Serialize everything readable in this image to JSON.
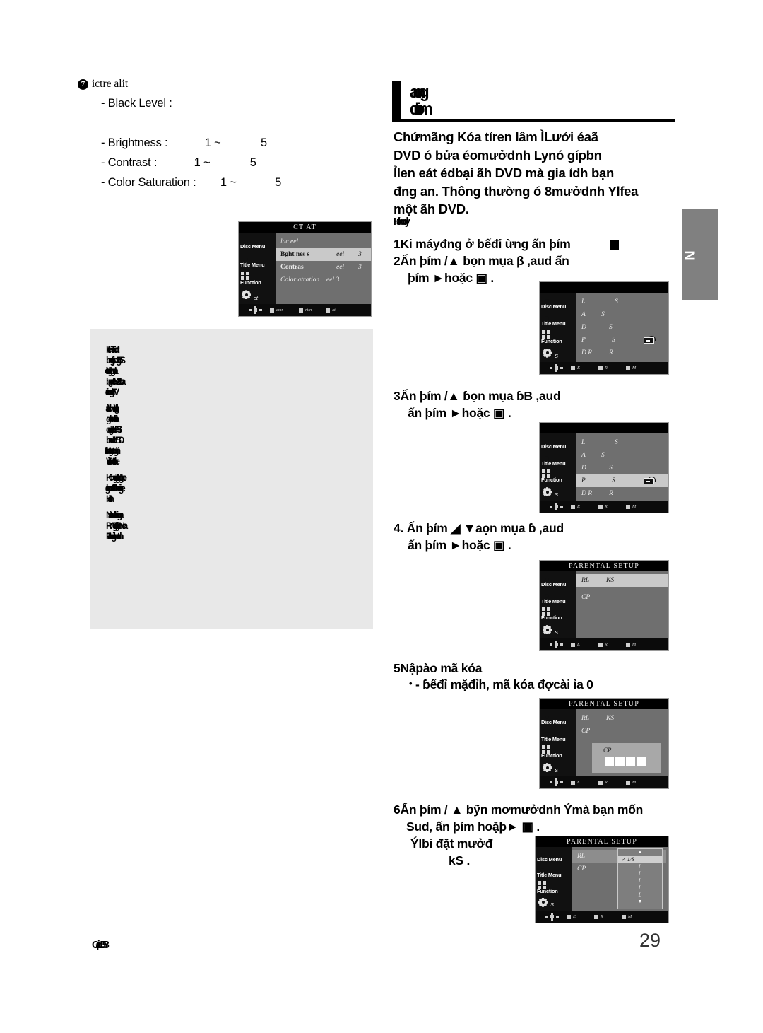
{
  "page": {
    "number": "29",
    "footer_code": "Gaip1058",
    "side_tab_letter": "N"
  },
  "left_column": {
    "section": {
      "bullet": "7",
      "heading": "ictre alit"
    },
    "settings": [
      {
        "label": "- Black Level :",
        "range": ""
      },
      {
        "label": "- Brightness :",
        "range": "1 ~",
        "max": "5"
      },
      {
        "label": "- Contrast :",
        "range": "1 ~",
        "max": "5"
      },
      {
        "label": "- Color Saturation :",
        "range": "1 ~",
        "max": "5"
      }
    ],
    "osd": {
      "title": "CT AT",
      "sidebar": [
        {
          "label": "Disc Menu",
          "icon": "disc-icon",
          "active": false
        },
        {
          "label": "Title Menu",
          "icon": "title-icon",
          "active": false
        },
        {
          "label": "Function",
          "icon": "function-icon",
          "active": false
        },
        {
          "label": "et",
          "icon": "gear-icon",
          "active": false
        }
      ],
      "rows": [
        {
          "c1": "lac eel",
          "c2": "",
          "c3": "",
          "selected": false
        },
        {
          "c1": "Bght nes s",
          "c2": "eel",
          "c3": "3",
          "selected": true
        },
        {
          "c1": "Contras",
          "c2": "eel",
          "c3": "3",
          "selected": false
        },
        {
          "c1": "Color atration",
          "c2": "eel 3",
          "c3": "",
          "selected": false
        }
      ],
      "footer": [
        "cmr",
        "rtin",
        "xt"
      ]
    },
    "note_lines": [
      "kfenTiacdt",
      "bngjtobJg5S",
      "tdg tiodvgnla",
      "bgnteleV2ctba",
      "icitongtleTV",
      "tatidchvietdlg",
      "gelndditnla",
      "cdigertloeFSi",
      "bndeIVBD",
      "leo lMgretoghi",
      "VlialsHtdtne",
      "Kchgiegltlotdgke",
      "lgndtdbhnieige",
      "Htiatlea",
      "Niatadchiegra",
      "RWZ gtelghNea",
      "Ftathcighetdn"
    ]
  },
  "right_column": {
    "header": {
      "line1": "anng",
      "line2": "dniom"
    },
    "intro": [
      "Chứmãng Kóa tỉren lâm ÌLưởi éaã",
      "DVD ó bửa éomưởdnh Lynó gípbn",
      "Ỉlen eát édbại ãh DVD mà gia ỉdh bạn",
      "đng an. Thông thường ó 8mưởdnh Ylfea",
      "một ãh DVD."
    ],
    "sec_label": "Hfanody",
    "steps": [
      {
        "n": "1",
        "lines": [
          "Ki máyđng ở bếđỉ ừng ấn þím"
        ],
        "trailing_icon": "button-icon"
      },
      {
        "n": "2",
        "lines": [
          "Ấn þím      /▲  bọn mụa            β           ,aud ấn",
          "þím   ►hoặc  ▣        ."
        ]
      },
      {
        "n": "3",
        "lines": [
          "Ấn þím      /▲  ɓọn mụa            ɓB              ,aud",
          "ấn þím   ►hoặc  ▣        ."
        ]
      },
      {
        "n": "4.",
        "lines": [
          "Ấn þím    ◢  ▼aọn mụa          ɓ              ,aud",
          "ấn þím   ►hoặc  ▣        ."
        ]
      },
      {
        "n": "5",
        "lines": [
          "Nậpào mã kóa",
          "- ɓếđỉ mặđỉh, mã kóa đợcài ỉa 0"
        ]
      },
      {
        "n": "6",
        "lines": [
          "Ấn þím    / ▲ bỹn mơmưởdnh Ýmà bạn mốn",
          "Sud, ấn þím      hoặþ►       ▣        .",
          "Ýlbi đặt mưởđ",
          "kS             ."
        ]
      }
    ],
    "osd_screens": [
      {
        "id": "osd-setup-language",
        "title": "",
        "sidebar": [
          {
            "label": "Disc Menu",
            "icon": "disc-icon"
          },
          {
            "label": "Title Menu",
            "icon": "title-icon"
          },
          {
            "label": "Function",
            "icon": "function-icon"
          },
          {
            "label": "S",
            "icon": "gear-icon"
          }
        ],
        "rows": [
          {
            "c1": "L",
            "c2": "S",
            "selected": false,
            "lock": false
          },
          {
            "c1": "A",
            "c2": "S",
            "selected": false,
            "lock": false
          },
          {
            "c1": "D",
            "c2": "S",
            "selected": false,
            "lock": false
          },
          {
            "c1": "P",
            "c2": "S",
            "selected": false,
            "lock": true
          },
          {
            "c1": "D R",
            "c2": "R",
            "selected": false,
            "lock": false
          }
        ],
        "footer": [
          "E",
          "R",
          "M"
        ]
      },
      {
        "id": "osd-parental-row-selected",
        "title": "",
        "sidebar": [
          {
            "label": "Disc Menu",
            "icon": "disc-icon"
          },
          {
            "label": "Title Menu",
            "icon": "title-icon"
          },
          {
            "label": "Function",
            "icon": "function-icon"
          },
          {
            "label": "S",
            "icon": "gear-icon"
          }
        ],
        "rows": [
          {
            "c1": "L",
            "c2": "S",
            "selected": false,
            "lock": false
          },
          {
            "c1": "A",
            "c2": "S",
            "selected": false,
            "lock": false
          },
          {
            "c1": "D",
            "c2": "S",
            "selected": false,
            "lock": false
          },
          {
            "c1": "P",
            "c2": "S",
            "selected": true,
            "lock": true
          },
          {
            "c1": "D R",
            "c2": "R",
            "selected": false,
            "lock": false
          }
        ],
        "footer": [
          "E",
          "R",
          "M"
        ]
      },
      {
        "id": "osd-parental-setup",
        "title": "PARENTAL SETUP",
        "sidebar": [
          {
            "label": "Disc Menu",
            "icon": "disc-icon"
          },
          {
            "label": "Title Menu",
            "icon": "title-icon"
          },
          {
            "label": "Function",
            "icon": "function-icon"
          },
          {
            "label": "S",
            "icon": "gear-icon"
          }
        ],
        "rows": [
          {
            "c1": "RL",
            "c2": "KS",
            "selected": true,
            "lock": false
          },
          {
            "c1": "CP",
            "c2": "",
            "selected": false,
            "lock": false
          }
        ],
        "footer": [
          "E",
          "R",
          "M"
        ]
      },
      {
        "id": "osd-password-entry",
        "title": "PARENTAL SETUP",
        "sidebar": [
          {
            "label": "Disc Menu",
            "icon": "disc-icon"
          },
          {
            "label": "Title Menu",
            "icon": "title-icon"
          },
          {
            "label": "Function",
            "icon": "function-icon"
          },
          {
            "label": "S",
            "icon": "gear-icon"
          }
        ],
        "rows": [
          {
            "c1": "RL",
            "c2": "KS",
            "selected": false,
            "lock": false
          },
          {
            "c1": "CP",
            "c2": "",
            "selected": false,
            "lock": false
          }
        ],
        "dialog": {
          "label": "CP",
          "boxes": 4
        },
        "footer": [
          "E",
          "R",
          "M"
        ]
      },
      {
        "id": "osd-rating-level-list",
        "title": "PARENTAL SETUP",
        "sidebar": [
          {
            "label": "Disc Menu",
            "icon": "disc-icon"
          },
          {
            "label": "Title Menu",
            "icon": "title-icon"
          },
          {
            "label": "Function",
            "icon": "function-icon"
          },
          {
            "label": "S",
            "icon": "gear-icon"
          }
        ],
        "rows": [
          {
            "c1": "RL",
            "c2": "",
            "selected": false,
            "lock": false
          },
          {
            "c1": "CP",
            "c2": "",
            "selected": false,
            "lock": false
          }
        ],
        "dropdown": {
          "up_arrow": "▲",
          "down_arrow": "▼",
          "items": [
            {
              "label": "1/S",
              "checked": true
            },
            {
              "label": "L",
              "checked": false
            },
            {
              "label": "L",
              "checked": false
            },
            {
              "label": "L",
              "checked": false
            },
            {
              "label": "L",
              "checked": false
            },
            {
              "label": "L",
              "checked": false
            }
          ]
        },
        "footer": [
          "E",
          "R",
          "M"
        ]
      }
    ]
  }
}
